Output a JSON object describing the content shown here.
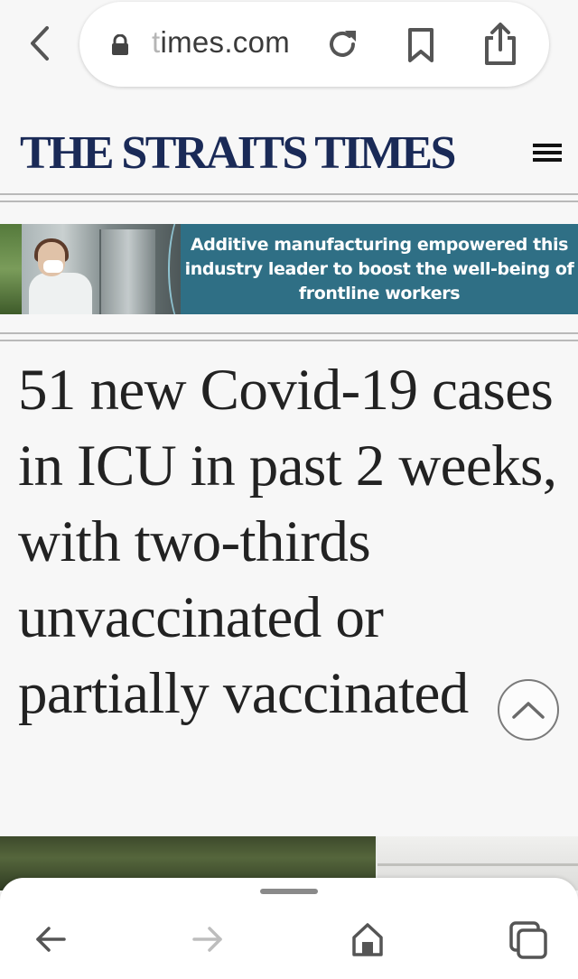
{
  "browser": {
    "url_faded": "t",
    "url_main": "imes.com"
  },
  "site": {
    "masthead": "THE STRAITS TIMES"
  },
  "ad": {
    "text": "Additive manufacturing empowered this industry leader to boost the well-being of frontline workers"
  },
  "article": {
    "headline": "51 new Covid-19 cases in ICU in past 2 weeks, with two-thirds unvaccinated or partially vaccinated"
  },
  "icons": {
    "back": "chevron-left-icon",
    "lock": "lock-icon",
    "reload": "reload-icon",
    "bookmark": "bookmark-icon",
    "share": "share-icon",
    "menu": "hamburger-menu-icon",
    "scroll_top": "chevron-up-icon",
    "nav_back": "arrow-left-icon",
    "nav_forward": "arrow-right-icon",
    "home": "home-icon",
    "tabs": "tabs-icon"
  },
  "colors": {
    "masthead": "#1a2a57",
    "ad_background": "#2f6f85"
  }
}
